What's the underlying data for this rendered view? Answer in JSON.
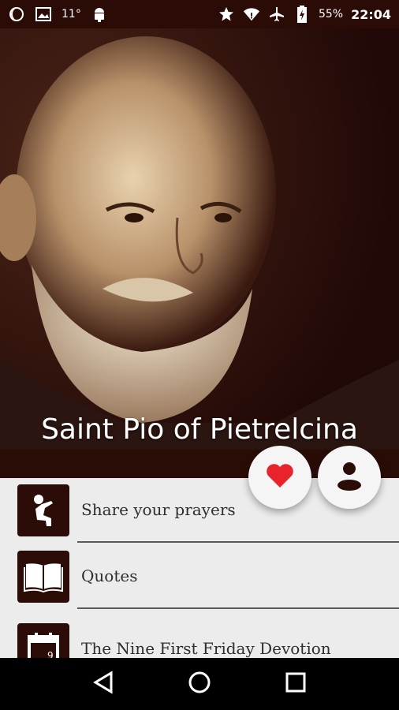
{
  "status_bar": {
    "temperature": "11°",
    "battery_percent": "55%",
    "time": "22:04",
    "icons": [
      "moon-icon",
      "image-icon",
      "android-icon",
      "star-icon",
      "wifi-icon",
      "airplane-icon",
      "battery-icon"
    ]
  },
  "hero": {
    "title": "Saint Pio of Pietrelcina",
    "image": "sepia-portrait"
  },
  "fabs": {
    "favorite_icon": "heart-icon",
    "profile_icon": "person-icon",
    "heart_color": "#e8232b"
  },
  "menu": {
    "items": [
      {
        "label": "Share your prayers",
        "icon": "praying-person-icon"
      },
      {
        "label": "Quotes",
        "icon": "open-book-icon"
      },
      {
        "label": "The Nine First Friday Devotion",
        "icon": "calendar-icon",
        "calendar_day": "9"
      }
    ]
  },
  "nav": {
    "icons": [
      "back-icon",
      "home-icon",
      "recents-icon"
    ]
  },
  "colors": {
    "accent": "#2c0c06",
    "status_bar": "#2a0b06",
    "list_background": "#ececec"
  }
}
